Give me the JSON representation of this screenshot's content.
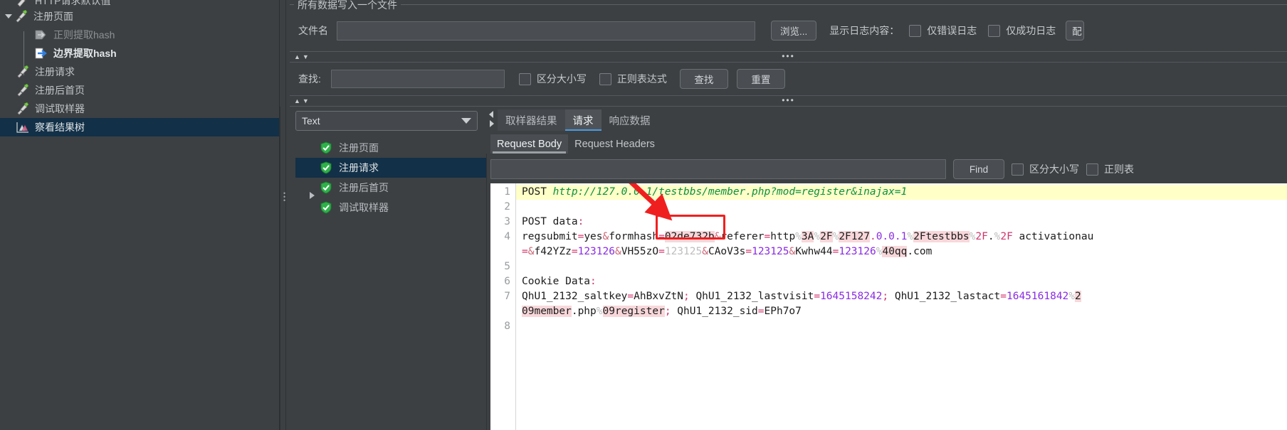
{
  "app": {
    "theme_bg": "#3c4043",
    "selection_color": "#123047",
    "accent_color": "#4b9ae4",
    "annotation_color": "#f01f1f"
  },
  "tree": {
    "items": [
      {
        "label": "HTTP请求默认值",
        "icon": "http-defaults-icon",
        "indent": 0,
        "twisty": "none",
        "selected": false,
        "dim": false
      },
      {
        "label": "注册页面",
        "icon": "sampler-icon",
        "indent": 0,
        "twisty": "open",
        "selected": false,
        "dim": false
      },
      {
        "label": "正则提取hash",
        "icon": "postprocessor-disabled-icon",
        "indent": 1,
        "twisty": "none",
        "selected": false,
        "dim": true
      },
      {
        "label": "边界提取hash",
        "icon": "postprocessor-icon",
        "indent": 1,
        "twisty": "none",
        "selected": false,
        "dim": false
      },
      {
        "label": "注册请求",
        "icon": "sampler-icon",
        "indent": 0,
        "twisty": "none",
        "selected": false,
        "dim": false
      },
      {
        "label": "注册后首页",
        "icon": "sampler-icon",
        "indent": 0,
        "twisty": "none",
        "selected": false,
        "dim": false
      },
      {
        "label": "调试取样器",
        "icon": "sampler-icon",
        "indent": 0,
        "twisty": "none",
        "selected": false,
        "dim": false
      },
      {
        "label": "察看结果树",
        "icon": "results-tree-icon",
        "indent": 0,
        "twisty": "none",
        "selected": true,
        "dim": false
      }
    ]
  },
  "file_group": {
    "title": "所有数据写入一个文件",
    "filename_label": "文件名",
    "filename_value": "",
    "browse_button": "浏览...",
    "log_display_label": "显示日志内容：",
    "checkbox_errors_only": "仅错误日志",
    "checkbox_errors_checked": false,
    "checkbox_success_only": "仅成功日志",
    "checkbox_success_checked": false,
    "configure_button": "配"
  },
  "search_bar": {
    "find_label": "查找:",
    "find_value": "",
    "checkbox_case": "区分大小写",
    "checkbox_case_checked": false,
    "checkbox_regex": "正则表达式",
    "checkbox_regex_checked": false,
    "find_button": "查找",
    "reset_button": "重置"
  },
  "sampler_pane": {
    "render_combo_value": "Text",
    "results": [
      {
        "label": "注册页面",
        "status": "success",
        "twisty": "none",
        "selected": false
      },
      {
        "label": "注册请求",
        "status": "success",
        "twisty": "none",
        "selected": true
      },
      {
        "label": "注册后首页",
        "status": "success",
        "twisty": "closed",
        "selected": false
      },
      {
        "label": "调试取样器",
        "status": "success",
        "twisty": "none",
        "selected": false
      }
    ]
  },
  "tabs": {
    "main": [
      {
        "label": "取样器结果",
        "active": false
      },
      {
        "label": "请求",
        "active": true
      },
      {
        "label": "响应数据",
        "active": false
      }
    ],
    "sub": [
      {
        "label": "Request Body",
        "active": true
      },
      {
        "label": "Request Headers",
        "active": false
      }
    ]
  },
  "find_bar": {
    "value": "",
    "find_button": "Find",
    "checkbox_case": "区分大小写",
    "checkbox_case_checked": false,
    "checkbox_regex": "正则表",
    "checkbox_regex_checked": false
  },
  "code": {
    "line_numbers": [
      "1",
      "2",
      "3",
      "4",
      "5",
      "6",
      "7",
      "8"
    ],
    "lines": [
      "POST http://127.0.0.1/testbbs/member.php?mod=register&inajax=1",
      "",
      "POST data:",
      "regsubmit=yes&formhash=02de732b&referer=http%3A%2F%2F127.0.0.1%2Ftestbbs%2F.%2F activationau",
      "=&f42YZz=123126&VH55zO=123125&CAoV3s=123125&Kwhw44=123126%40qq.com",
      "",
      "Cookie Data:",
      "QhU1_2132_saltkey=AhBxvZtN; QhU1_2132_lastvisit=1645158242; QhU1_2132_lastact=1645161842%2",
      "09member.php%09register; QhU1_2132_sid=EPh7o7",
      ""
    ],
    "highlighted_token": "02de732b",
    "tokens": {
      "method": "POST",
      "url": "http://127.0.0.1/testbbs/member.php?mod=register&inajax=1",
      "post_data_label": "POST data",
      "cookie_data_label": "Cookie Data",
      "formhash_value": "02de732b",
      "saltkey": "AhBxvZtN",
      "lastvisit": "1645158242",
      "lastact": "1645161842",
      "sid": "EPh7o7",
      "params": [
        {
          "name": "regsubmit",
          "value": "yes"
        },
        {
          "name": "formhash",
          "value": "02de732b"
        },
        {
          "name": "f42YZz",
          "value": "123126"
        },
        {
          "name": "VH55zO",
          "value": "123125"
        },
        {
          "name": "CAoV3s",
          "value": "123125"
        },
        {
          "name": "Kwhw44",
          "value": "123126"
        }
      ]
    }
  }
}
